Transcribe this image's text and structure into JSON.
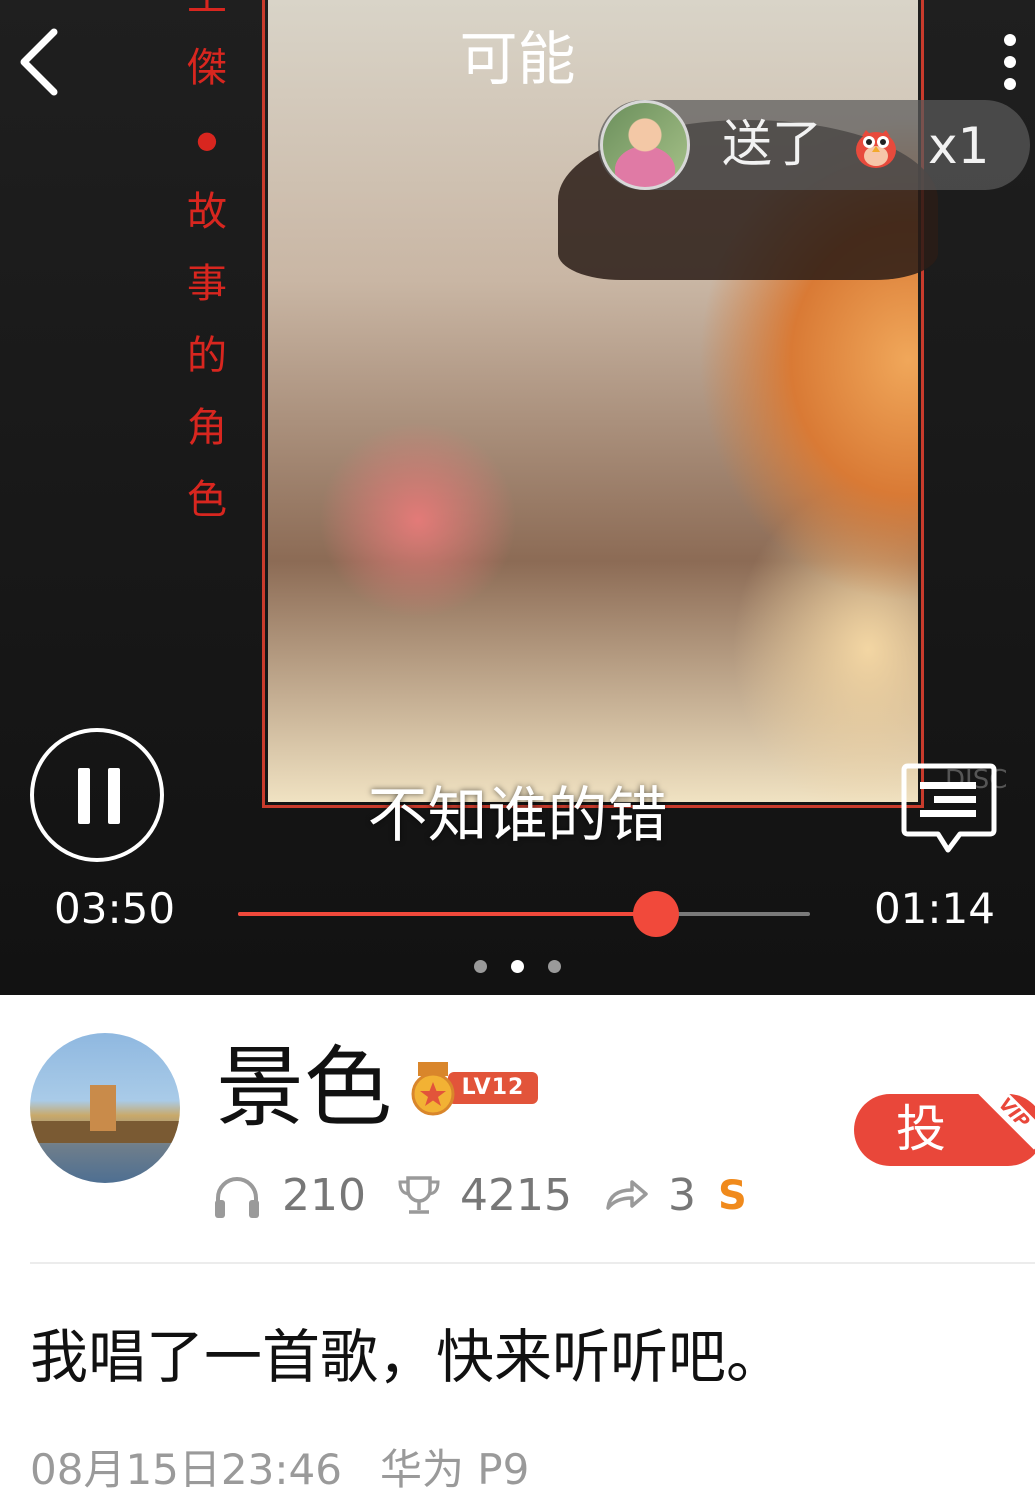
{
  "header": {
    "title": "可能"
  },
  "cover": {
    "side_text": [
      "王",
      "傑",
      "●",
      "故",
      "事",
      "的",
      "角",
      "色"
    ],
    "disc_mark": "DISC"
  },
  "gift_notice": {
    "text": "送了",
    "count": "x1",
    "gift_icon": "cartoon-bird-gift-icon"
  },
  "player": {
    "lyric": "不知谁的错",
    "elapsed": "03:50",
    "remaining": "01:14",
    "progress_fraction": 0.73,
    "page_count": 3,
    "active_page": 1,
    "accent_color": "#f1493b"
  },
  "user": {
    "name": "景色",
    "level": "LV12",
    "listens": "210",
    "trophies": "4215",
    "shares": "3",
    "s_badge": "S"
  },
  "vote": {
    "label": "投",
    "vip": "VIP"
  },
  "post": {
    "description": "我唱了一首歌，快来听听吧。",
    "datetime": "08月15日23:46",
    "device": "华为 P9"
  }
}
